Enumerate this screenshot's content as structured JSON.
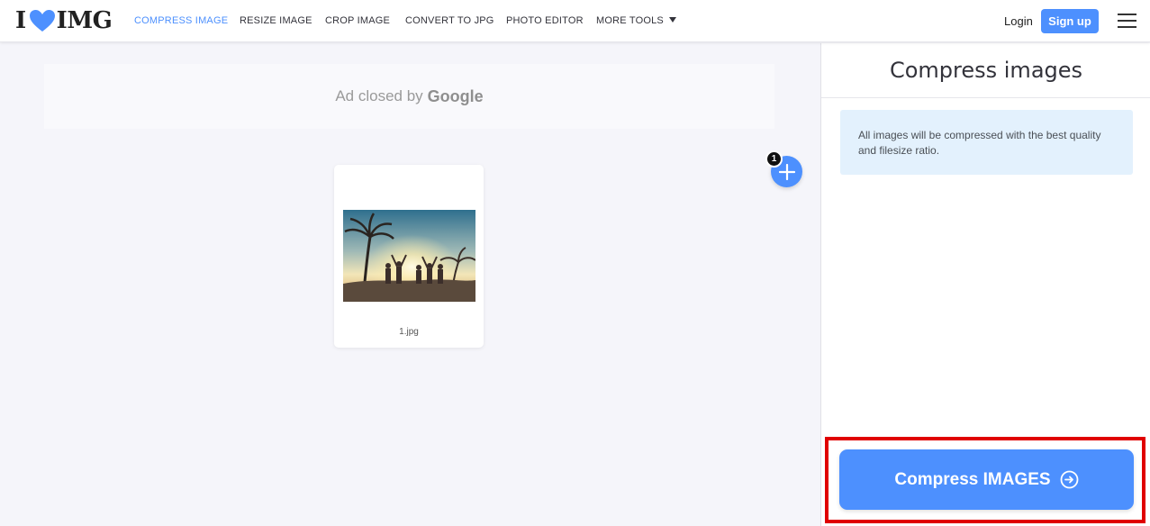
{
  "header": {
    "logo_text_left": "I",
    "logo_text_right": "IMG",
    "nav": [
      {
        "label": "COMPRESS IMAGE",
        "active": true
      },
      {
        "label": "RESIZE IMAGE",
        "active": false
      },
      {
        "label": "CROP IMAGE",
        "active": false
      },
      {
        "label": "CONVERT TO JPG",
        "active": false
      },
      {
        "label": "PHOTO EDITOR",
        "active": false
      },
      {
        "label": "MORE TOOLS",
        "active": false
      }
    ],
    "login_label": "Login",
    "signup_label": "Sign up"
  },
  "ad": {
    "text": "Ad closed by",
    "brand": "Google"
  },
  "uploader": {
    "file_count": "1",
    "files": [
      {
        "name": "1.jpg"
      }
    ]
  },
  "sidebar": {
    "title": "Compress images",
    "info": "All images will be compressed with the best quality and filesize ratio.",
    "action_label": "Compress IMAGES"
  },
  "colors": {
    "accent": "#4d90fe",
    "info_bg": "#e3f1fd",
    "highlight": "#e00000"
  },
  "icons": {
    "logo": "heart-icon",
    "more_tools": "caret-down-icon",
    "menu": "hamburger-icon",
    "add": "plus-icon",
    "action": "arrow-right-circle-icon"
  }
}
